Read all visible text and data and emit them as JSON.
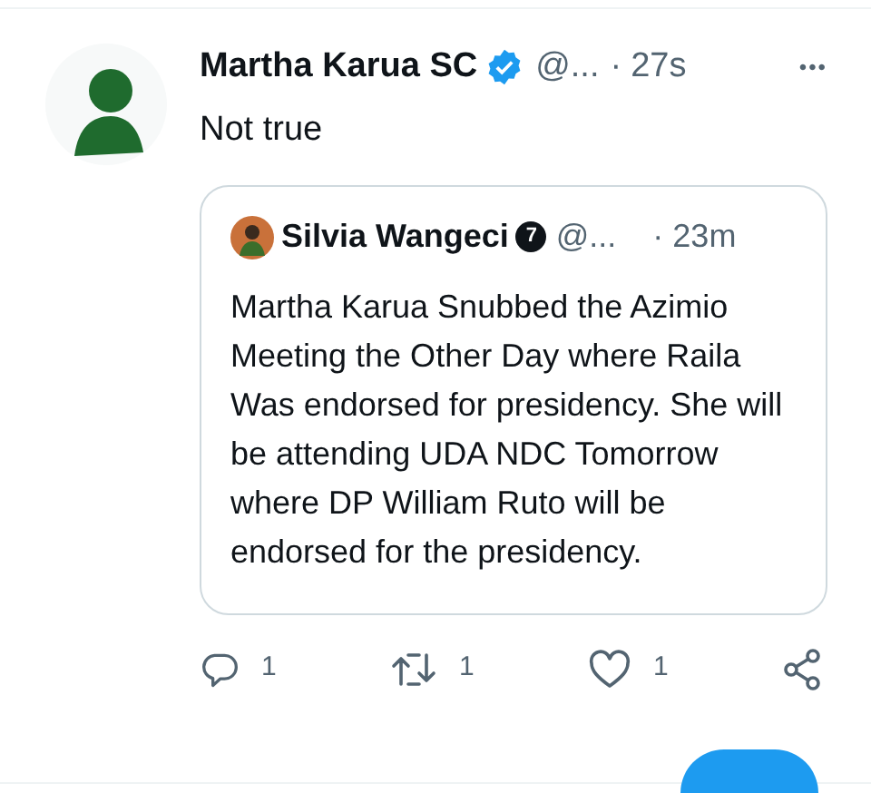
{
  "tweet": {
    "display_name": "Martha Karua SC",
    "verified": true,
    "handle": "@...",
    "separator": "·",
    "time": "27s",
    "more": "•••",
    "text": "Not true",
    "quoted": {
      "display_name": "Silvia Wangeci",
      "badge": "7",
      "handle": "@...",
      "separator": "·",
      "time": "23m",
      "text": "Martha Karua Snubbed the Azimio Meeting the Other Day where Raila Was endorsed for presidency. She will be attending UDA NDC Tomorrow where DP William Ruto will be endorsed for the presidency."
    },
    "actions": [
      {
        "kind": "reply",
        "count": "1"
      },
      {
        "kind": "retweet",
        "count": "1"
      },
      {
        "kind": "like",
        "count": "1"
      },
      {
        "kind": "share"
      }
    ]
  }
}
